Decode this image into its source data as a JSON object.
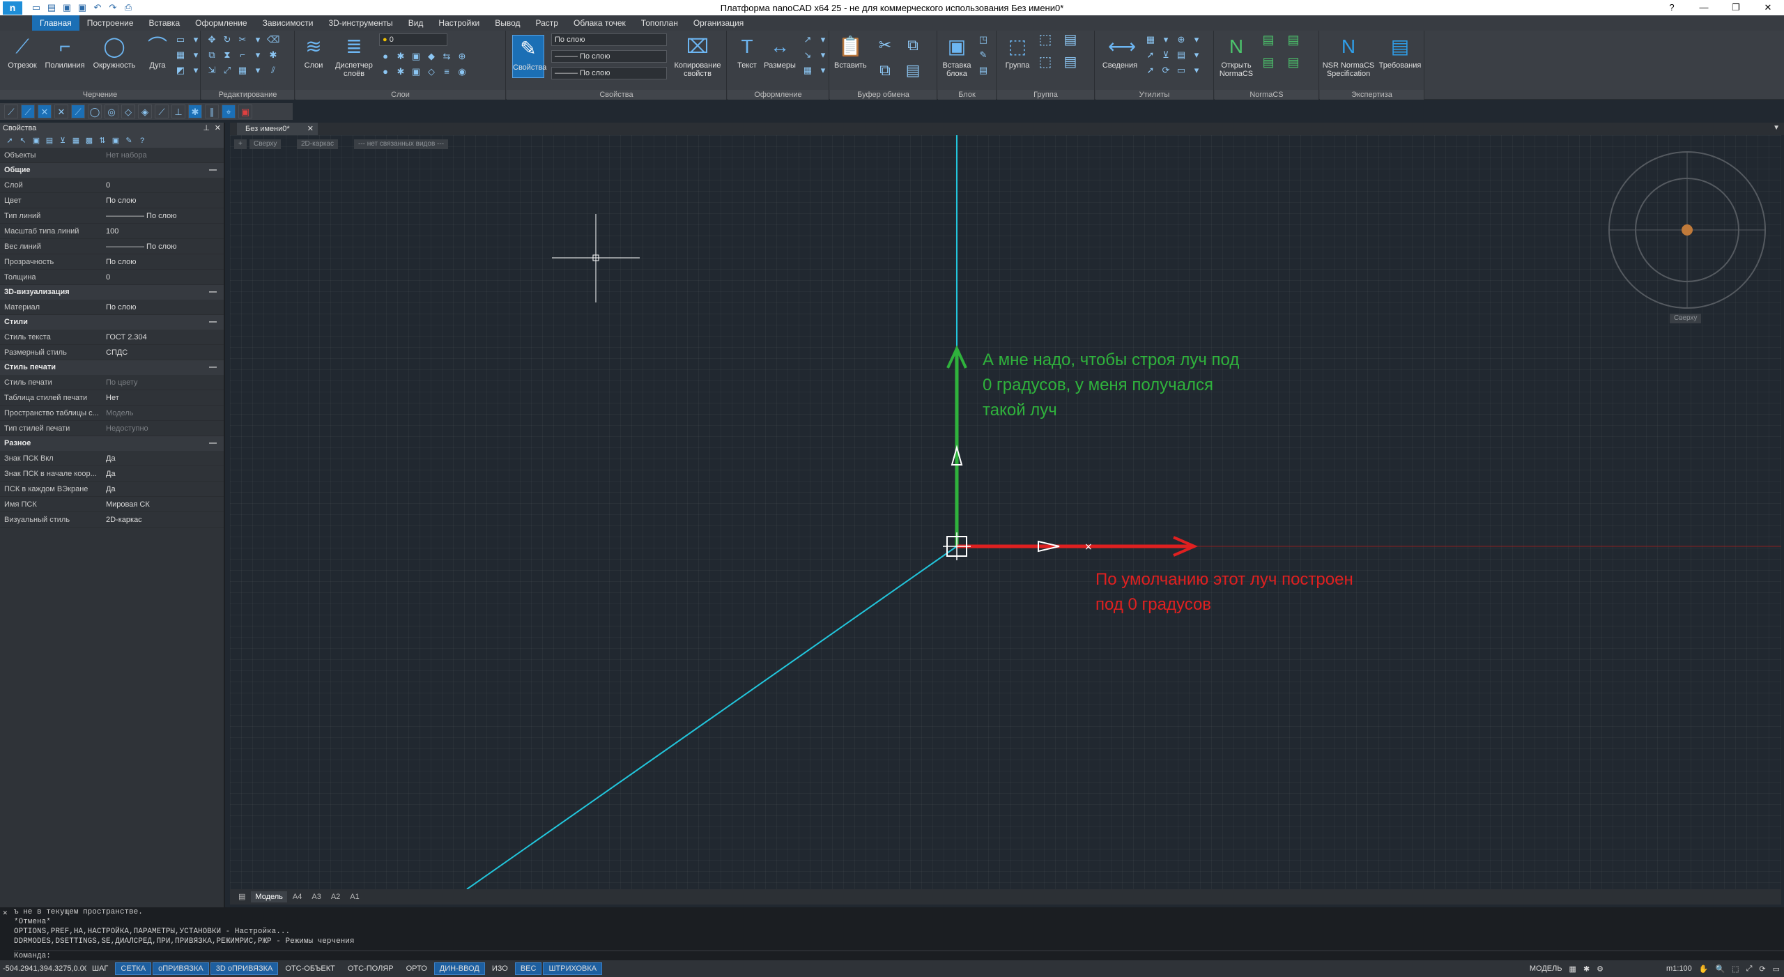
{
  "titlebar": {
    "logo": "n",
    "title": "Платформа nanoCAD x64 25 - не для коммерческого использования Без имени0*"
  },
  "menu": [
    "Главная",
    "Построение",
    "Вставка",
    "Оформление",
    "Зависимости",
    "3D-инструменты",
    "Вид",
    "Настройки",
    "Вывод",
    "Растр",
    "Облака точек",
    "Топоплан",
    "Организация"
  ],
  "ribbon": {
    "draw": {
      "label": "Черчение",
      "b1": "Отрезок",
      "b2": "Полилиния",
      "b3": "Окружность",
      "b4": "Дуга"
    },
    "edit": {
      "label": "Редактирование"
    },
    "layers": {
      "label": "Слои",
      "b1": "Слои",
      "b2a": "Диспетчер",
      "b2b": "слоёв",
      "dd": "0"
    },
    "props": {
      "label": "Свойства",
      "b1": "Свойства",
      "dd1": "По слою",
      "dd2": "——— По слою",
      "dd3": "——— По слою",
      "b2a": "Копирование",
      "b2b": "свойств"
    },
    "design": {
      "label": "Оформление",
      "b1": "Текст",
      "b2": "Размеры"
    },
    "clip": {
      "label": "Буфер обмена",
      "b1": "Вставить"
    },
    "block": {
      "label": "Блок",
      "b1a": "Вставка",
      "b1b": "блока"
    },
    "group": {
      "label": "Группа",
      "b1": "Группа"
    },
    "utils": {
      "label": "Утилиты",
      "b1": "Сведения"
    },
    "normacs": {
      "label": "NormaCS",
      "b1a": "Открыть",
      "b1b": "NormaCS"
    },
    "expert": {
      "label": "Экспертиза",
      "b1a": "NSR NormaCS",
      "b1b": "Specification",
      "b2": "Требования"
    }
  },
  "props_panel": {
    "title": "Свойства",
    "rows_top": [
      {
        "k": "Объекты",
        "v": "Нет набора",
        "dim": true
      }
    ],
    "sections": [
      {
        "title": "Общие",
        "rows": [
          {
            "k": "Слой",
            "v": "0"
          },
          {
            "k": "Цвет",
            "v": "По слою"
          },
          {
            "k": "Тип линий",
            "v": "————— По слою"
          },
          {
            "k": "Масштаб типа линий",
            "v": "100"
          },
          {
            "k": "Вес линий",
            "v": "————— По слою"
          },
          {
            "k": "Прозрачность",
            "v": "По слою"
          },
          {
            "k": "Толщина",
            "v": "0"
          }
        ]
      },
      {
        "title": "3D-визуализация",
        "rows": [
          {
            "k": "Материал",
            "v": "По слою"
          }
        ]
      },
      {
        "title": "Стили",
        "rows": [
          {
            "k": "Стиль текста",
            "v": "ГОСТ 2.304"
          },
          {
            "k": "Размерный стиль",
            "v": "СПДС"
          }
        ]
      },
      {
        "title": "Стиль печати",
        "rows": [
          {
            "k": "Стиль печати",
            "v": "По цвету",
            "dim": true
          },
          {
            "k": "Таблица стилей печати",
            "v": "Нет"
          },
          {
            "k": "Пространство таблицы с...",
            "v": "Модель",
            "dim": true
          },
          {
            "k": "Тип стилей печати",
            "v": "Недоступно",
            "dim": true
          }
        ]
      },
      {
        "title": "Разное",
        "rows": [
          {
            "k": "Знак ПСК Вкл",
            "v": "Да"
          },
          {
            "k": "Знак ПСК в начале коор...",
            "v": "Да"
          },
          {
            "k": "ПСК в каждом ВЭкране",
            "v": "Да"
          },
          {
            "k": "Имя ПСК",
            "v": "Мировая СК"
          },
          {
            "k": "Визуальный стиль",
            "v": "2D-каркас"
          }
        ]
      }
    ]
  },
  "doc_tab": "Без имени0*",
  "viewport": {
    "btn_plus": "+",
    "btn_view": "Сверху",
    "btn_style": "2D-каркас",
    "btn_linked": "--- нет связанных видов ---",
    "viewcube": "Сверху",
    "note_green": [
      "А мне надо, чтобы строя луч под",
      "0 градусов, у меня получался",
      "такой луч"
    ],
    "note_red": [
      "По умолчанию этот луч построен",
      "под 0 градусов"
    ]
  },
  "layout_tabs": [
    "Модель",
    "A4",
    "A3",
    "A2",
    "A1"
  ],
  "cmd": [
    "ъ не в текущем пространстве.",
    "*Отмена*",
    "OPTIONS,PREF,НА,НАСТРОЙКА,ПАРАМЕТРЫ,УСТАНОВКИ - Настройка...",
    "DDRMODES,DSETTINGS,SE,ДИАЛСРЕД,ПРИ,ПРИВЯЗКА,РЕЖИМРИС,РЖР - Режимы черчения",
    "Команда:"
  ],
  "status": {
    "coords": "-504.2941,394.3275,0.0000",
    "buttons": [
      {
        "t": "ШАГ",
        "on": false
      },
      {
        "t": "СЕТКА",
        "on": true
      },
      {
        "t": "оПРИВЯЗКА",
        "on": true
      },
      {
        "t": "3D оПРИВЯЗКА",
        "on": true
      },
      {
        "t": "ОТС-ОБЪЕКТ",
        "on": false
      },
      {
        "t": "ОТС-ПОЛЯР",
        "on": false
      },
      {
        "t": "ОРТО",
        "on": false
      },
      {
        "t": "ДИН-ВВОД",
        "on": true
      },
      {
        "t": "ИЗО",
        "on": false
      },
      {
        "t": "ВЕС",
        "on": true
      },
      {
        "t": "ШТРИХОВКА",
        "on": true
      }
    ],
    "model": "МОДЕЛЬ",
    "scale": "m1:100"
  },
  "colors": {
    "accent": "#1b6fb5",
    "green": "#2fb23c",
    "red": "#e02020",
    "cyan": "#22c6dc"
  }
}
